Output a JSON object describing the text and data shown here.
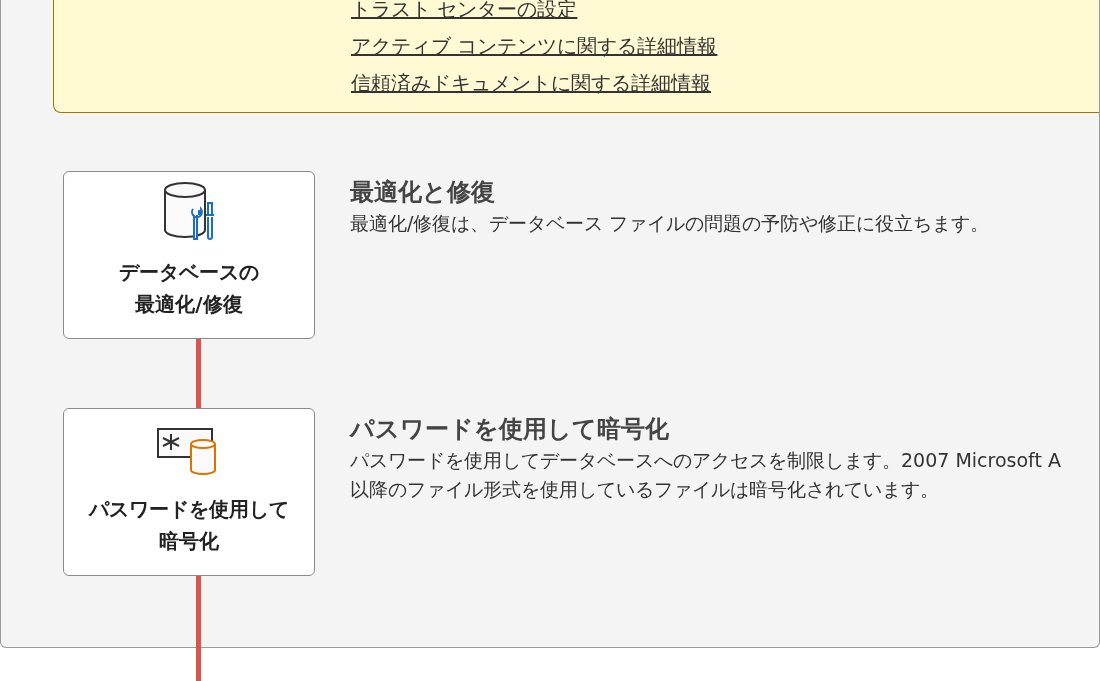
{
  "trust_links": [
    "トラスト センターの設定",
    "アクティブ コンテンツに関する詳細情報",
    "信頼済みドキュメントに関する詳細情報"
  ],
  "sections": [
    {
      "kind": "compact",
      "button_lines": [
        "データベースの",
        "最適化/修復"
      ],
      "heading": "最適化と修復",
      "description_lines": [
        "最適化/修復は、データベース ファイルの問題の予防や修正に役立ちます。"
      ]
    },
    {
      "kind": "encrypt",
      "button_lines": [
        "パスワードを使用して",
        "暗号化"
      ],
      "heading": "パスワードを使用して暗号化",
      "description_lines": [
        "パスワードを使用してデータベースへのアクセスを制限します。2007 Microsoft A",
        "以降のファイル形式を使用しているファイルは暗号化されています。"
      ]
    }
  ]
}
